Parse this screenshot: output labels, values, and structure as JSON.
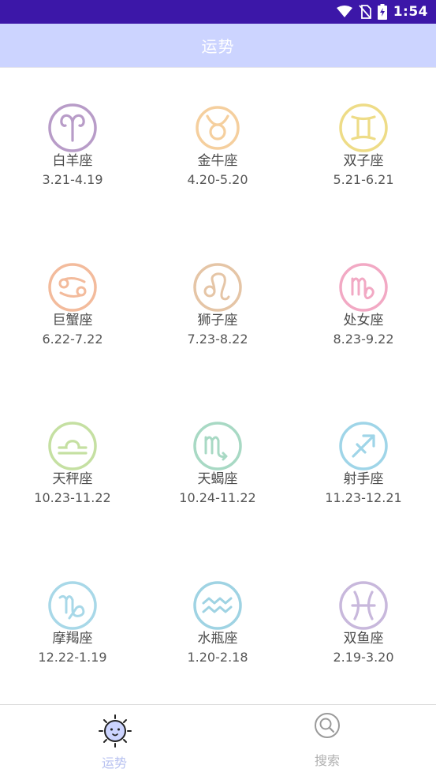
{
  "status_bar": {
    "time": "1:54"
  },
  "app_bar": {
    "title": "运势"
  },
  "signs": [
    {
      "name": "白羊座",
      "dates": "3.21-4.19",
      "color": "#b89cc8",
      "icon": "aries-icon"
    },
    {
      "name": "金牛座",
      "dates": "4.20-5.20",
      "color": "#f5cf9e",
      "icon": "taurus-icon"
    },
    {
      "name": "双子座",
      "dates": "5.21-6.21",
      "color": "#eedc87",
      "icon": "gemini-icon"
    },
    {
      "name": "巨蟹座",
      "dates": "6.22-7.22",
      "color": "#f3bb9c",
      "icon": "cancer-icon"
    },
    {
      "name": "狮子座",
      "dates": "7.23-8.22",
      "color": "#e5c5a6",
      "icon": "leo-icon"
    },
    {
      "name": "处女座",
      "dates": "8.23-9.22",
      "color": "#f2a9c4",
      "icon": "virgo-icon"
    },
    {
      "name": "天秤座",
      "dates": "10.23-11.22",
      "color": "#c5e0a2",
      "icon": "libra-icon"
    },
    {
      "name": "天蝎座",
      "dates": "10.24-11.22",
      "color": "#a8d9c4",
      "icon": "scorpio-icon"
    },
    {
      "name": "射手座",
      "dates": "11.23-12.21",
      "color": "#9fd5e8",
      "icon": "sagittarius-icon"
    },
    {
      "name": "摩羯座",
      "dates": "12.22-1.19",
      "color": "#a8d8e8",
      "icon": "capricorn-icon"
    },
    {
      "name": "水瓶座",
      "dates": "1.20-2.18",
      "color": "#9fd3e3",
      "icon": "aquarius-icon"
    },
    {
      "name": "双鱼座",
      "dates": "2.19-3.20",
      "color": "#c8b8dc",
      "icon": "pisces-icon"
    }
  ],
  "bottom_nav": {
    "items": [
      {
        "label": "运势",
        "active": true,
        "color": "#b8c2f0"
      },
      {
        "label": "搜索",
        "active": false,
        "color": "#b0b0b0"
      }
    ]
  }
}
